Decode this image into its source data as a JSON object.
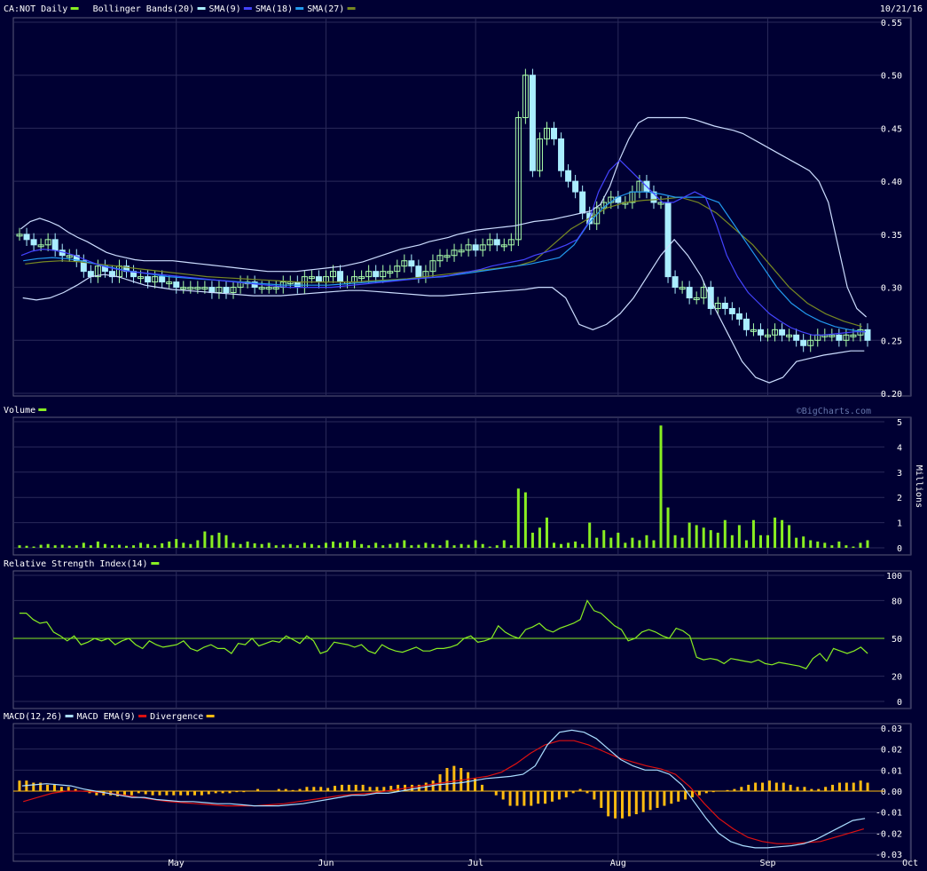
{
  "header": {
    "date": "10/21/16",
    "watermark": "©BigCharts.com"
  },
  "colors": {
    "background": "#000033",
    "panel_border": "#5a5a7a",
    "grid": "#2a2a5a",
    "price_candle_up": "#aaffaa",
    "price_candle_down": "#aaeeff",
    "bollinger": "#ccddff",
    "sma9": "#4444ff",
    "sma18": "#2299ee",
    "sma27": "#778822",
    "volume": "#88ee22",
    "rsi": "#88ee22",
    "rsi_ref": "#88ee22",
    "macd": "#aaddff",
    "macd_ema": "#dd1111",
    "divergence": "#ffbb11"
  },
  "legends": {
    "price": [
      {
        "label": "CA:NOT Daily",
        "color": "#88ee22"
      },
      {
        "label": "Bollinger Bands(20)",
        "color": "#aaeeff"
      },
      {
        "label": "SMA(9)",
        "color": "#4444ff"
      },
      {
        "label": "SMA(18)",
        "color": "#2299ee"
      },
      {
        "label": "SMA(27)",
        "color": "#778822"
      }
    ],
    "volume": [
      {
        "label": "Volume",
        "color": "#88ee22"
      }
    ],
    "rsi": [
      {
        "label": "Relative Strength Index(14)",
        "color": "#88ee22"
      }
    ],
    "macd": [
      {
        "label": "MACD(12,26)",
        "color": "#aaddff"
      },
      {
        "label": "MACD EMA(9)",
        "color": "#dd1111"
      },
      {
        "label": "Divergence",
        "color": "#ffbb11"
      }
    ]
  },
  "chart_data": [
    {
      "type": "candlestick",
      "panel": "price",
      "ylim": [
        0.2,
        0.55
      ],
      "y_ticks": [
        "0.55",
        "0.50",
        "0.45",
        "0.40",
        "0.35",
        "0.30",
        "0.25",
        "0.20"
      ],
      "x_ticks": [
        "May",
        "Jun",
        "Jul",
        "Aug",
        "Sep",
        "Oct"
      ],
      "x_tick_days": [
        22,
        43,
        64,
        84,
        105,
        125
      ],
      "close": [
        0.35,
        0.345,
        0.34,
        0.34,
        0.345,
        0.335,
        0.33,
        0.33,
        0.325,
        0.315,
        0.31,
        0.32,
        0.315,
        0.31,
        0.32,
        0.315,
        0.31,
        0.31,
        0.305,
        0.31,
        0.305,
        0.305,
        0.3,
        0.3,
        0.3,
        0.3,
        0.3,
        0.295,
        0.3,
        0.295,
        0.3,
        0.305,
        0.305,
        0.3,
        0.3,
        0.3,
        0.3,
        0.305,
        0.305,
        0.3,
        0.31,
        0.31,
        0.305,
        0.31,
        0.315,
        0.305,
        0.305,
        0.31,
        0.31,
        0.315,
        0.31,
        0.315,
        0.315,
        0.32,
        0.325,
        0.32,
        0.31,
        0.315,
        0.325,
        0.33,
        0.33,
        0.335,
        0.335,
        0.34,
        0.335,
        0.34,
        0.345,
        0.34,
        0.34,
        0.345,
        0.46,
        0.5,
        0.41,
        0.44,
        0.45,
        0.44,
        0.41,
        0.4,
        0.39,
        0.37,
        0.36,
        0.375,
        0.38,
        0.385,
        0.38,
        0.38,
        0.39,
        0.4,
        0.39,
        0.38,
        0.38,
        0.31,
        0.3,
        0.3,
        0.29,
        0.29,
        0.3,
        0.28,
        0.285,
        0.28,
        0.275,
        0.27,
        0.26,
        0.26,
        0.255,
        0.255,
        0.26,
        0.255,
        0.255,
        0.25,
        0.245,
        0.25,
        0.255,
        0.255,
        0.255,
        0.25,
        0.255,
        0.255,
        0.26,
        0.25
      ],
      "bollinger_upper": [
        0.355,
        0.362,
        0.365,
        0.362,
        0.358,
        0.352,
        0.347,
        0.343,
        0.338,
        0.333,
        0.33,
        0.328,
        0.326,
        0.325,
        0.325,
        0.325,
        0.325,
        0.324,
        0.323,
        0.322,
        0.321,
        0.32,
        0.319,
        0.318,
        0.317,
        0.316,
        0.315,
        0.315,
        0.315,
        0.315,
        0.316,
        0.317,
        0.318,
        0.319,
        0.32,
        0.322,
        0.324,
        0.327,
        0.33,
        0.333,
        0.336,
        0.338,
        0.34,
        0.343,
        0.345,
        0.347,
        0.35,
        0.352,
        0.354,
        0.355,
        0.356,
        0.357,
        0.358,
        0.36,
        0.362,
        0.363,
        0.364,
        0.366,
        0.368,
        0.37,
        0.372,
        0.378,
        0.395,
        0.42,
        0.44,
        0.455,
        0.46,
        0.46,
        0.46,
        0.46,
        0.46,
        0.458,
        0.455,
        0.452,
        0.45,
        0.448,
        0.445,
        0.44,
        0.435,
        0.43,
        0.425,
        0.42,
        0.415,
        0.41,
        0.4,
        0.38,
        0.34,
        0.3,
        0.28,
        0.272
      ],
      "bollinger_lower": [
        0.29,
        0.288,
        0.29,
        0.295,
        0.302,
        0.31,
        0.312,
        0.31,
        0.306,
        0.302,
        0.3,
        0.298,
        0.297,
        0.296,
        0.295,
        0.294,
        0.293,
        0.292,
        0.292,
        0.292,
        0.293,
        0.294,
        0.295,
        0.296,
        0.297,
        0.297,
        0.296,
        0.295,
        0.294,
        0.293,
        0.292,
        0.292,
        0.293,
        0.294,
        0.295,
        0.296,
        0.297,
        0.298,
        0.3,
        0.3,
        0.29,
        0.265,
        0.26,
        0.265,
        0.275,
        0.29,
        0.31,
        0.33,
        0.345,
        0.33,
        0.31,
        0.28,
        0.255,
        0.23,
        0.215,
        0.21,
        0.215,
        0.23,
        0.233,
        0.236,
        0.238,
        0.24,
        0.24
      ],
      "sma9": [
        0.33,
        0.334,
        0.336,
        0.335,
        0.333,
        0.33,
        0.326,
        0.322,
        0.319,
        0.317,
        0.315,
        0.314,
        0.313,
        0.312,
        0.311,
        0.31,
        0.309,
        0.308,
        0.307,
        0.306,
        0.305,
        0.304,
        0.303,
        0.302,
        0.301,
        0.3,
        0.3,
        0.3,
        0.3,
        0.3,
        0.301,
        0.302,
        0.303,
        0.304,
        0.305,
        0.306,
        0.307,
        0.308,
        0.309,
        0.31,
        0.311,
        0.313,
        0.315,
        0.317,
        0.32,
        0.322,
        0.324,
        0.326,
        0.33,
        0.333,
        0.336,
        0.34,
        0.345,
        0.36,
        0.39,
        0.41,
        0.42,
        0.41,
        0.4,
        0.39,
        0.38,
        0.38,
        0.385,
        0.39,
        0.385,
        0.36,
        0.33,
        0.31,
        0.295,
        0.285,
        0.275,
        0.268,
        0.262,
        0.258,
        0.255,
        0.255,
        0.256,
        0.257,
        0.258,
        0.258
      ],
      "sma18": [
        0.325,
        0.327,
        0.328,
        0.327,
        0.325,
        0.322,
        0.319,
        0.316,
        0.314,
        0.312,
        0.31,
        0.309,
        0.308,
        0.307,
        0.306,
        0.305,
        0.304,
        0.303,
        0.302,
        0.302,
        0.302,
        0.302,
        0.303,
        0.304,
        0.305,
        0.306,
        0.307,
        0.308,
        0.309,
        0.31,
        0.312,
        0.314,
        0.316,
        0.318,
        0.32,
        0.322,
        0.325,
        0.328,
        0.34,
        0.36,
        0.375,
        0.385,
        0.39,
        0.39,
        0.388,
        0.385,
        0.385,
        0.385,
        0.38,
        0.36,
        0.34,
        0.32,
        0.3,
        0.285,
        0.275,
        0.268,
        0.263,
        0.26,
        0.258
      ],
      "sma27": [
        0.322,
        0.324,
        0.325,
        0.324,
        0.322,
        0.32,
        0.318,
        0.316,
        0.314,
        0.312,
        0.31,
        0.309,
        0.308,
        0.307,
        0.306,
        0.305,
        0.305,
        0.305,
        0.305,
        0.306,
        0.307,
        0.308,
        0.31,
        0.312,
        0.314,
        0.316,
        0.318,
        0.32,
        0.325,
        0.34,
        0.355,
        0.365,
        0.375,
        0.38,
        0.382,
        0.383,
        0.385,
        0.38,
        0.37,
        0.355,
        0.34,
        0.32,
        0.3,
        0.285,
        0.275,
        0.268,
        0.263
      ]
    },
    {
      "type": "bar",
      "panel": "volume",
      "ylabel": "Millions",
      "ylim": [
        0,
        5
      ],
      "y_ticks": [
        "5",
        "4",
        "3",
        "2",
        "1",
        "0"
      ],
      "values": [
        0.1,
        0.08,
        0.05,
        0.12,
        0.15,
        0.1,
        0.12,
        0.08,
        0.1,
        0.2,
        0.1,
        0.25,
        0.15,
        0.1,
        0.12,
        0.08,
        0.1,
        0.2,
        0.15,
        0.1,
        0.18,
        0.25,
        0.35,
        0.2,
        0.15,
        0.3,
        0.65,
        0.5,
        0.6,
        0.5,
        0.2,
        0.15,
        0.25,
        0.18,
        0.15,
        0.2,
        0.1,
        0.12,
        0.15,
        0.1,
        0.2,
        0.15,
        0.1,
        0.2,
        0.25,
        0.2,
        0.25,
        0.3,
        0.15,
        0.1,
        0.2,
        0.1,
        0.15,
        0.2,
        0.3,
        0.1,
        0.12,
        0.2,
        0.15,
        0.1,
        0.3,
        0.1,
        0.15,
        0.12,
        0.3,
        0.15,
        0.05,
        0.1,
        0.3,
        0.1,
        2.35,
        2.2,
        0.6,
        0.8,
        1.2,
        0.2,
        0.15,
        0.2,
        0.25,
        0.15,
        1.0,
        0.4,
        0.7,
        0.4,
        0.6,
        0.2,
        0.4,
        0.3,
        0.5,
        0.3,
        4.85,
        1.6,
        0.5,
        0.4,
        1.0,
        0.9,
        0.8,
        0.7,
        0.6,
        1.1,
        0.5,
        0.9,
        0.3,
        1.1,
        0.5,
        0.5,
        1.2,
        1.1,
        0.9,
        0.4,
        0.45,
        0.3,
        0.25,
        0.2,
        0.1,
        0.25,
        0.1,
        0.05,
        0.2,
        0.3
      ],
      "x_ticks": [
        "May",
        "Jun",
        "Jul",
        "Aug",
        "Sep",
        "Oct"
      ]
    },
    {
      "type": "line",
      "panel": "rsi",
      "ylim": [
        0,
        100
      ],
      "y_ticks": [
        "100",
        "80",
        "50",
        "20",
        "0"
      ],
      "reference": 50,
      "values": [
        70,
        70,
        65,
        62,
        63,
        55,
        52,
        48,
        52,
        45,
        47,
        50,
        48,
        50,
        45,
        48,
        50,
        45,
        42,
        48,
        45,
        43,
        44,
        45,
        48,
        42,
        40,
        43,
        45,
        42,
        42,
        38,
        46,
        45,
        50,
        44,
        46,
        48,
        47,
        52,
        49,
        46,
        52,
        48,
        38,
        40,
        47,
        46,
        45,
        43,
        45,
        40,
        38,
        45,
        42,
        40,
        39,
        41,
        43,
        40,
        40,
        42,
        42,
        43,
        45,
        50,
        52,
        47,
        48,
        50,
        60,
        55,
        52,
        50,
        57,
        59,
        62,
        57,
        55,
        58,
        60,
        62,
        65,
        80,
        72,
        70,
        65,
        60,
        57,
        48,
        50,
        55,
        57,
        55,
        52,
        50,
        58,
        56,
        52,
        35,
        33,
        34,
        33,
        30,
        34,
        33,
        32,
        31,
        33,
        30,
        29,
        31,
        30,
        29,
        28,
        26,
        34,
        38,
        32,
        42,
        40,
        38,
        40,
        43,
        38
      ],
      "x_ticks": [
        "May",
        "Jun",
        "Jul",
        "Aug",
        "Sep",
        "Oct"
      ]
    },
    {
      "type": "line",
      "panel": "macd",
      "ylim": [
        -0.03,
        0.03
      ],
      "y_ticks": [
        "0.03",
        "0.02",
        "0.01",
        "0.00",
        "-0.01",
        "-0.02",
        "-0.03"
      ],
      "series": [
        {
          "name": "MACD(12,26)",
          "values": [
            0.0025,
            0.003,
            0.0035,
            0.003,
            0.0025,
            0.001,
            0.0,
            -0.001,
            -0.002,
            -0.003,
            -0.003,
            -0.004,
            -0.0045,
            -0.005,
            -0.005,
            -0.0055,
            -0.006,
            -0.006,
            -0.0065,
            -0.007,
            -0.007,
            -0.007,
            -0.0065,
            -0.006,
            -0.005,
            -0.004,
            -0.003,
            -0.002,
            -0.002,
            -0.001,
            -0.001,
            0.0,
            0.001,
            0.002,
            0.003,
            0.0035,
            0.004,
            0.005,
            0.006,
            0.0065,
            0.007,
            0.008,
            0.012,
            0.022,
            0.028,
            0.029,
            0.028,
            0.025,
            0.02,
            0.015,
            0.012,
            0.01,
            0.01,
            0.008,
            0.003,
            -0.005,
            -0.013,
            -0.02,
            -0.024,
            -0.026,
            -0.027,
            -0.027,
            -0.0265,
            -0.026,
            -0.025,
            -0.023,
            -0.02,
            -0.017,
            -0.014,
            -0.013
          ]
        },
        {
          "name": "MACD EMA(9)",
          "values": [
            -0.005,
            -0.003,
            -0.001,
            0.0,
            0.0,
            -0.0005,
            -0.001,
            -0.002,
            -0.003,
            -0.004,
            -0.005,
            -0.0055,
            -0.006,
            -0.0065,
            -0.007,
            -0.007,
            -0.007,
            -0.0065,
            -0.006,
            -0.005,
            -0.004,
            -0.003,
            -0.002,
            -0.0015,
            -0.001,
            0.0,
            0.001,
            0.002,
            0.003,
            0.004,
            0.005,
            0.006,
            0.007,
            0.009,
            0.013,
            0.018,
            0.022,
            0.024,
            0.024,
            0.022,
            0.019,
            0.016,
            0.014,
            0.012,
            0.0105,
            0.008,
            0.002,
            -0.006,
            -0.013,
            -0.018,
            -0.022,
            -0.024,
            -0.025,
            -0.025,
            -0.0245,
            -0.024,
            -0.022,
            -0.02,
            -0.018
          ]
        },
        {
          "name": "Divergence",
          "values": [
            0.005,
            0.005,
            0.004,
            0.004,
            0.003,
            0.003,
            0.002,
            0.002,
            0.001,
            0.0,
            -0.001,
            -0.002,
            -0.002,
            -0.002,
            -0.0025,
            -0.002,
            -0.002,
            -0.001,
            -0.0015,
            -0.002,
            -0.002,
            -0.002,
            -0.002,
            -0.002,
            -0.002,
            -0.002,
            -0.002,
            -0.0015,
            -0.001,
            -0.001,
            -0.001,
            -0.0005,
            -0.0005,
            0.0,
            0.001,
            0.0,
            0.0,
            0.001,
            0.001,
            0.0005,
            0.001,
            0.002,
            0.002,
            0.002,
            0.0015,
            0.0025,
            0.003,
            0.003,
            0.003,
            0.003,
            0.002,
            0.002,
            0.002,
            0.0025,
            0.003,
            0.003,
            0.003,
            0.003,
            0.004,
            0.005,
            0.008,
            0.011,
            0.012,
            0.011,
            0.009,
            0.006,
            0.003,
            0.0,
            -0.002,
            -0.004,
            -0.007,
            -0.007,
            -0.007,
            -0.007,
            -0.006,
            -0.006,
            -0.005,
            -0.004,
            -0.003,
            -0.001,
            0.001,
            -0.001,
            -0.004,
            -0.008,
            -0.012,
            -0.013,
            -0.013,
            -0.012,
            -0.011,
            -0.01,
            -0.009,
            -0.008,
            -0.007,
            -0.006,
            -0.005,
            -0.004,
            -0.003,
            -0.002,
            -0.001,
            -0.0005,
            0.0,
            0.0005,
            0.001,
            0.002,
            0.003,
            0.004,
            0.004,
            0.005,
            0.004,
            0.004,
            0.003,
            0.002,
            0.002,
            0.001,
            0.001,
            0.002,
            0.003,
            0.004,
            0.004,
            0.004,
            0.005,
            0.004
          ]
        }
      ],
      "x_ticks": [
        "May",
        "Jun",
        "Jul",
        "Aug",
        "Sep",
        "Oct"
      ]
    }
  ]
}
